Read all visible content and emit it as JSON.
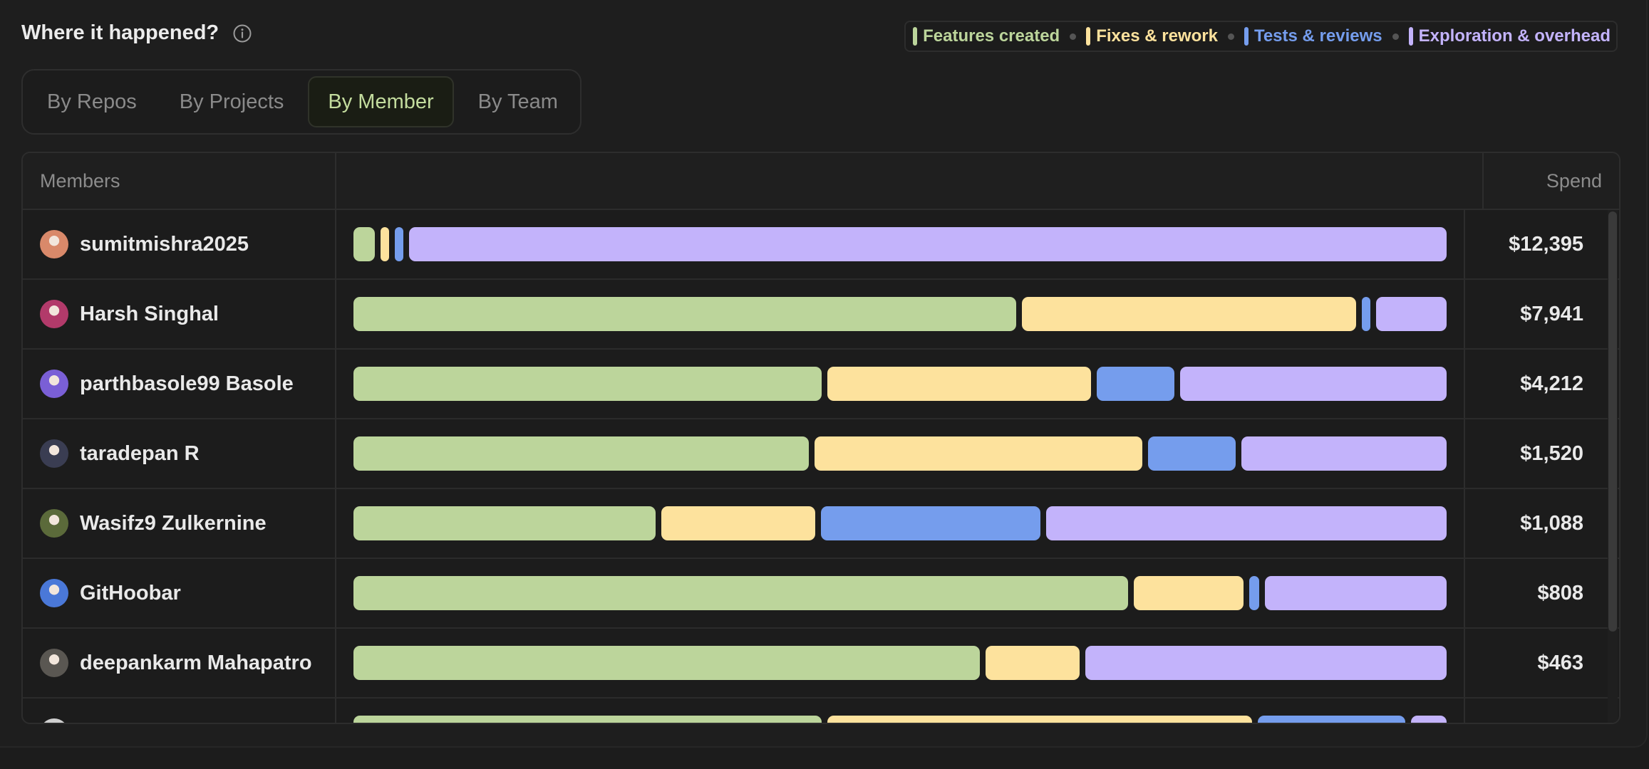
{
  "header": {
    "title": "Where it happened?",
    "info_icon": "info-icon"
  },
  "legend": [
    {
      "label": "Features created",
      "color": "#bcd59b"
    },
    {
      "label": "Fixes & rework",
      "color": "#fde29d"
    },
    {
      "label": "Tests & reviews",
      "color": "#759ded"
    },
    {
      "label": "Exploration & overhead",
      "color": "#c3b3fb"
    }
  ],
  "tabs": [
    {
      "label": "By Repos",
      "active": false
    },
    {
      "label": "By Projects",
      "active": false
    },
    {
      "label": "By Member",
      "active": true
    },
    {
      "label": "By Team",
      "active": false
    }
  ],
  "table": {
    "col_members": "Members",
    "col_spend": "Spend",
    "rows": [
      {
        "name": "sumitmishra2025",
        "spend": "$12,395",
        "avatar_color": "#d9896a",
        "segments": [
          2.0,
          0.8,
          0.8,
          96.4
        ]
      },
      {
        "name": "Harsh Singhal",
        "spend": "$7,941",
        "avatar_color": "#b23a6a",
        "segments": [
          61.0,
          30.7,
          0.8,
          6.5
        ]
      },
      {
        "name": "parthbasole99 Basole",
        "spend": "$4,212",
        "avatar_color": "#7a5fd6",
        "segments": [
          43.5,
          24.5,
          7.2,
          24.8
        ]
      },
      {
        "name": "taradepan R",
        "spend": "$1,520",
        "avatar_color": "#3a3d52",
        "segments": [
          42.3,
          30.5,
          8.1,
          19.1
        ]
      },
      {
        "name": "Wasifz9 Zulkernine",
        "spend": "$1,088",
        "avatar_color": "#5b6a3a",
        "segments": [
          28.1,
          14.3,
          20.4,
          37.2
        ]
      },
      {
        "name": "GitHoobar",
        "spend": "$808",
        "avatar_color": "#4a78d8",
        "segments": [
          72.0,
          10.2,
          0.9,
          16.9
        ]
      },
      {
        "name": "deepankarm Mahapatro",
        "spend": "$463",
        "avatar_color": "#5a5752",
        "segments": [
          57.9,
          8.7,
          0,
          33.4
        ]
      },
      {
        "name": "",
        "spend": "",
        "avatar_color": "#cfcfcf",
        "segments": [
          43.5,
          39.5,
          13.7,
          3.3
        ]
      }
    ]
  }
}
